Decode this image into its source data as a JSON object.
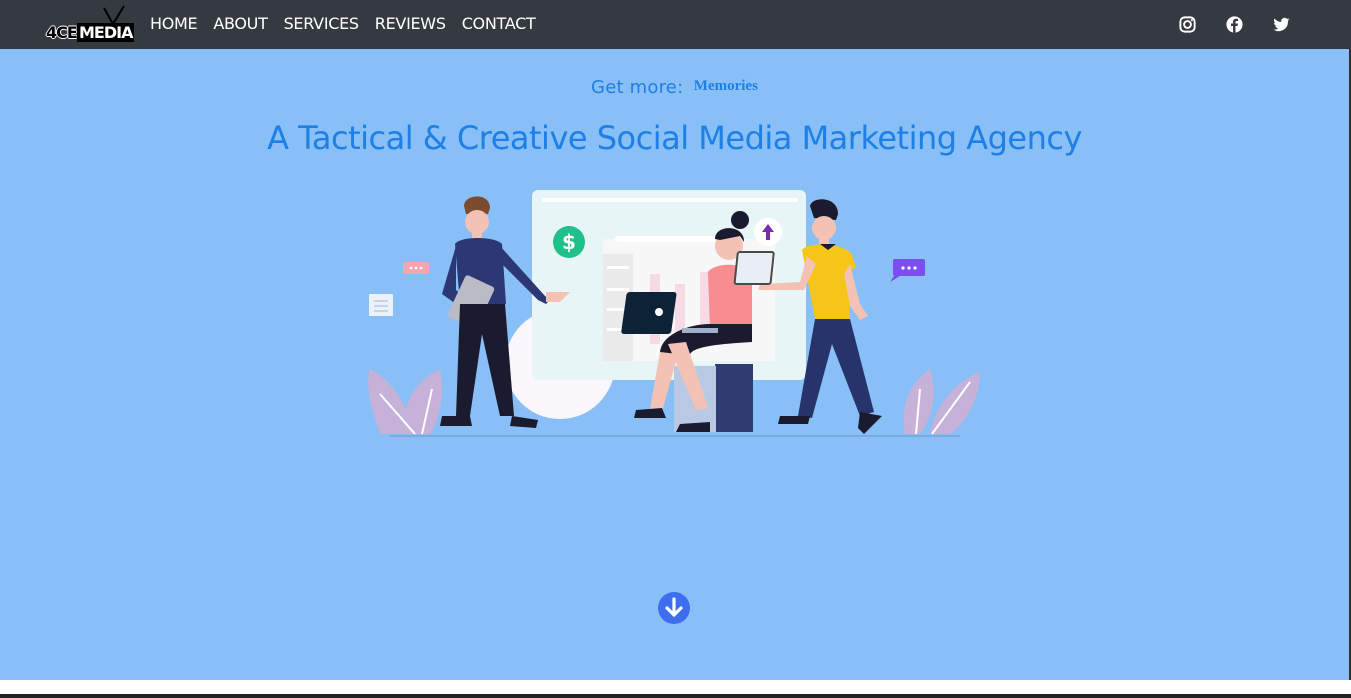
{
  "brand": {
    "logo_left": "4CE",
    "logo_right": "MEDIA"
  },
  "nav": {
    "items": [
      {
        "label": "HOME"
      },
      {
        "label": "ABOUT"
      },
      {
        "label": "SERVICES"
      },
      {
        "label": "REVIEWS"
      },
      {
        "label": "CONTACT"
      }
    ]
  },
  "social": [
    {
      "icon": "instagram-icon"
    },
    {
      "icon": "facebook-icon"
    },
    {
      "icon": "twitter-icon"
    }
  ],
  "hero": {
    "tagline_prefix": "Get more:",
    "tagline_word": "Memories",
    "headline": "A Tactical & Creative Social Media Marketing Agency",
    "illustration": "team-marketing-illustration",
    "scroll_icon": "arrow-down-circle-icon"
  },
  "colors": {
    "navbar": "#343a40",
    "hero_background": "#87bff6",
    "accent_text": "#1e7fe6",
    "scroll_button": "#3d6ef0"
  }
}
